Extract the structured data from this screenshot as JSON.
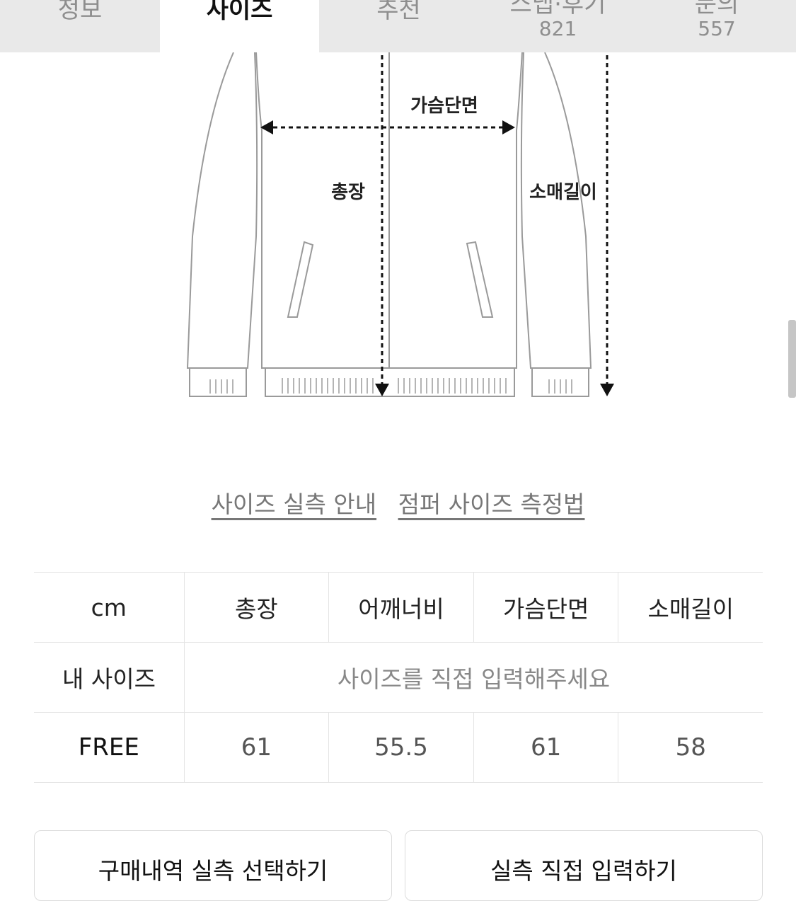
{
  "tabs": [
    {
      "label": "정보",
      "count": ""
    },
    {
      "label": "사이즈",
      "count": ""
    },
    {
      "label": "추천",
      "count": ""
    },
    {
      "label": "스냅·후기",
      "count": "821"
    },
    {
      "label": "문의",
      "count": "557"
    }
  ],
  "diagram": {
    "label_chest": "가슴단면",
    "label_length": "총장",
    "label_sleeve": "소매길이"
  },
  "guide_links": {
    "size_guide": "사이즈 실측 안내",
    "jumper_measure": "점퍼 사이즈 측정법"
  },
  "size_table": {
    "header": {
      "unit": "cm",
      "columns": [
        "총장",
        "어깨너비",
        "가슴단면",
        "소매길이"
      ]
    },
    "my_size": {
      "label": "내 사이즈",
      "prompt": "사이즈를 직접 입력해주세요"
    },
    "rows": [
      {
        "size": "FREE",
        "values": [
          "61",
          "55.5",
          "61",
          "58"
        ]
      }
    ]
  },
  "buttons": {
    "select_from_purchases": "구매내역 실측 선택하기",
    "enter_directly": "실측 직접 입력하기"
  }
}
